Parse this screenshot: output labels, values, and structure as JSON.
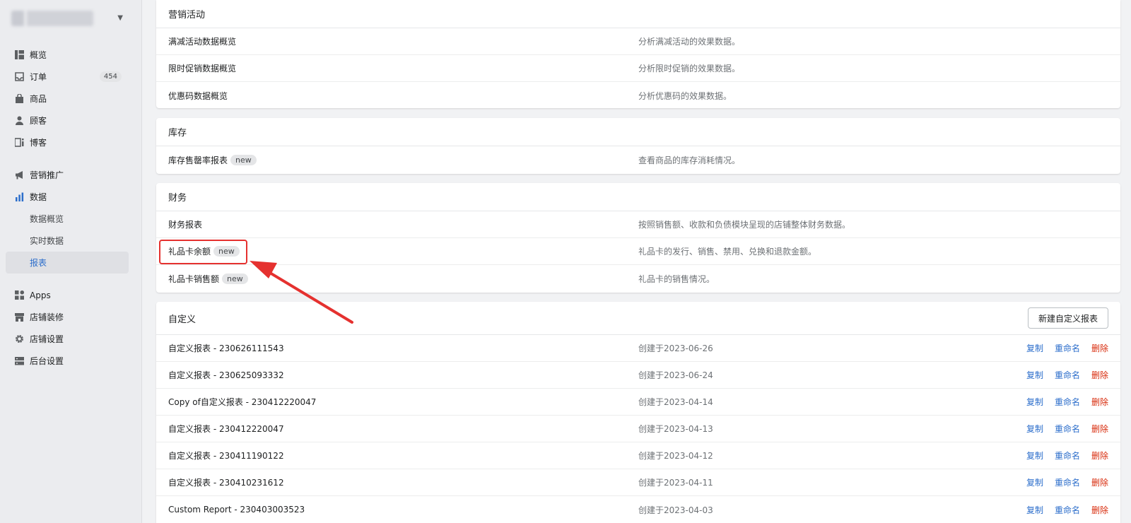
{
  "sidebar": {
    "nav": [
      {
        "label": "概览",
        "icon": "dashboard-icon"
      },
      {
        "label": "订单",
        "icon": "inbox-icon",
        "count": "454"
      },
      {
        "label": "商品",
        "icon": "bag-icon"
      },
      {
        "label": "顾客",
        "icon": "person-icon"
      },
      {
        "label": "博客",
        "icon": "blog-icon"
      }
    ],
    "nav2": [
      {
        "label": "营销推广",
        "icon": "megaphone-icon"
      },
      {
        "label": "数据",
        "icon": "bar-chart-icon"
      }
    ],
    "data_sub": [
      {
        "label": "数据概览"
      },
      {
        "label": "实时数据"
      },
      {
        "label": "报表"
      }
    ],
    "nav3": [
      {
        "label": "Apps",
        "icon": "apps-icon"
      },
      {
        "label": "店铺装修",
        "icon": "store-icon"
      },
      {
        "label": "店铺设置",
        "icon": "gear-icon"
      },
      {
        "label": "后台设置",
        "icon": "server-icon"
      }
    ]
  },
  "sections": {
    "marketing": {
      "title": "营销活动",
      "rows": [
        {
          "name": "满减活动数据概览",
          "desc": "分析满减活动的效果数据。"
        },
        {
          "name": "限时促销数据概览",
          "desc": "分析限时促销的效果数据。"
        },
        {
          "name": "优惠码数据概览",
          "desc": "分析优惠码的效果数据。"
        }
      ]
    },
    "inventory": {
      "title": "库存",
      "rows": [
        {
          "name": "库存售罄率报表",
          "tag": "new",
          "desc": "查看商品的库存消耗情况。"
        }
      ]
    },
    "finance": {
      "title": "财务",
      "rows": [
        {
          "name": "财务报表",
          "desc": "按照销售额、收款和负债模块呈现的店铺整体财务数据。"
        },
        {
          "name": "礼品卡余额",
          "tag": "new",
          "desc": "礼品卡的发行、销售、禁用、兑换和退款金额。"
        },
        {
          "name": "礼品卡销售额",
          "tag": "new",
          "desc": "礼品卡的销售情况。"
        }
      ]
    },
    "custom": {
      "title": "自定义",
      "new_button": "新建自定义报表",
      "actions": {
        "copy": "复制",
        "rename": "重命名",
        "delete": "删除"
      },
      "rows": [
        {
          "name": "自定义报表 - 230626111543",
          "created": "创建于2023-06-26"
        },
        {
          "name": "自定义报表 - 230625093332",
          "created": "创建于2023-06-24"
        },
        {
          "name": "Copy of自定义报表 - 230412220047",
          "created": "创建于2023-04-14"
        },
        {
          "name": "自定义报表 - 230412220047",
          "created": "创建于2023-04-13"
        },
        {
          "name": "自定义报表 - 230411190122",
          "created": "创建于2023-04-12"
        },
        {
          "name": "自定义报表 - 230410231612",
          "created": "创建于2023-04-11"
        },
        {
          "name": "Custom Report - 230403003523",
          "created": "创建于2023-04-03"
        }
      ]
    }
  },
  "colors": {
    "accent": "#2c6ecb",
    "danger": "#d82c0d",
    "annotation": "#e5312f"
  }
}
